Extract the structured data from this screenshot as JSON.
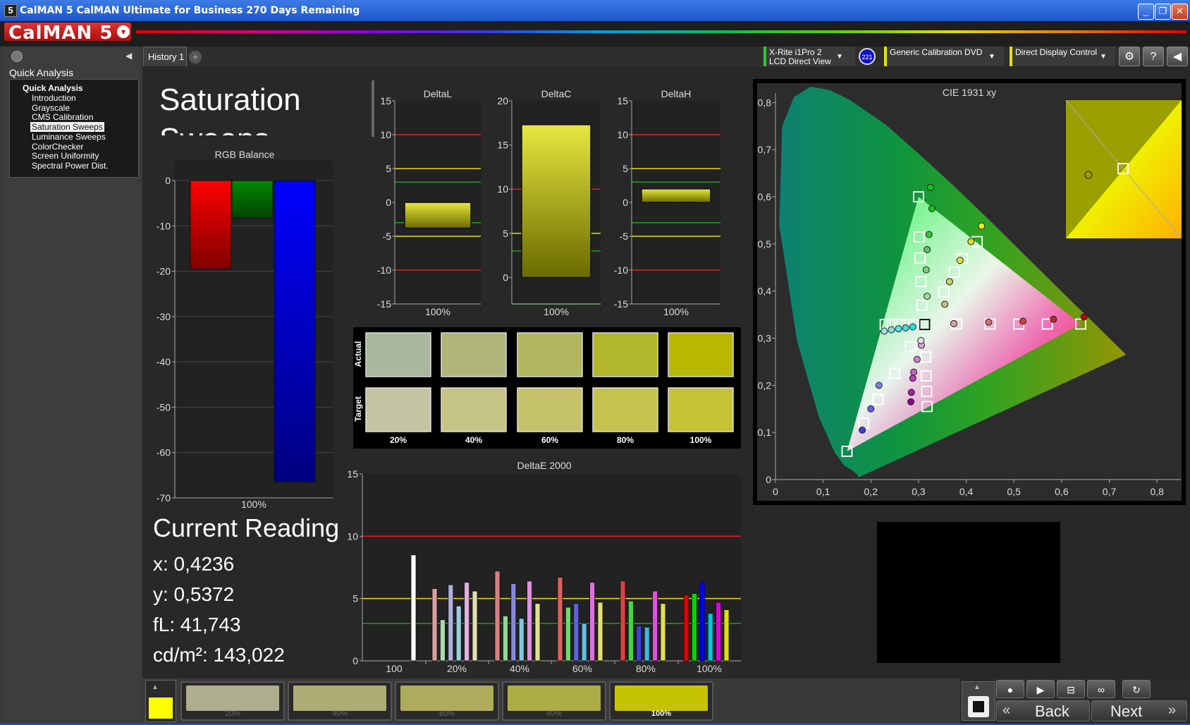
{
  "window": {
    "title": "CalMAN 5 CalMAN Ultimate for Business 270 Days Remaining",
    "icon_label": "5",
    "buttons": {
      "minimize": "_",
      "restore": "❐",
      "close": "✕"
    }
  },
  "logo": {
    "text": "CalMAN 5",
    "menu_glyph": "▾"
  },
  "sidebar": {
    "title": "Quick Analysis",
    "tree_root": "Quick Analysis",
    "items": [
      {
        "label": "Introduction",
        "selected": false
      },
      {
        "label": "Grayscale",
        "selected": false
      },
      {
        "label": "CMS Calibration",
        "selected": false
      },
      {
        "label": "Saturation Sweeps",
        "selected": true
      },
      {
        "label": "Luminance Sweeps",
        "selected": false
      },
      {
        "label": "ColorChecker",
        "selected": false
      },
      {
        "label": "Screen Uniformity",
        "selected": false
      },
      {
        "label": "Spectral Power Dist.",
        "selected": false
      }
    ]
  },
  "tabs": [
    {
      "label": "History 1"
    }
  ],
  "tab_add": "+",
  "devices": {
    "meter": {
      "line1": "X-Rite i1Pro 2",
      "line2": "LCD Direct View",
      "accent": "#2ccc2c"
    },
    "meter_badge": "221",
    "source": {
      "label": "Generic Calibration DVD",
      "accent": "#e8e000"
    },
    "display": {
      "label": "Direct Display Control",
      "accent": "#e8e000"
    }
  },
  "page": {
    "title": "Saturation Sweeps"
  },
  "current_reading": {
    "title": "Current Reading",
    "x": "x: 0,4236",
    "y": "y: 0,5372",
    "fl": "fL: 41,743",
    "cd": "cd/m²: 143,022"
  },
  "chart_data": [
    {
      "id": "rgb-balance",
      "type": "bar",
      "title": "RGB Balance",
      "categories": [
        "100%"
      ],
      "series": [
        {
          "color": "#ff0000",
          "values": [
            -19.5
          ]
        },
        {
          "color": "#008a00",
          "values": [
            -8.3
          ]
        },
        {
          "color": "#0000ff",
          "values": [
            -66.5
          ]
        }
      ],
      "ylim": [
        -70,
        0
      ],
      "yticks": [
        0,
        -10,
        -20,
        -30,
        -40,
        -50,
        -60,
        -70
      ]
    },
    {
      "id": "delta-l",
      "type": "bar",
      "title": "DeltaL",
      "categories": [
        "100%"
      ],
      "values": [
        -3.8
      ],
      "ylim": [
        -15,
        15
      ],
      "yticks": [
        15,
        10,
        5,
        0,
        -5,
        -10,
        -15
      ],
      "ref_lines": [
        {
          "y": 10,
          "color": "#e02020"
        },
        {
          "y": -10,
          "color": "#e02020"
        },
        {
          "y": 5,
          "color": "#e8e000"
        },
        {
          "y": -5,
          "color": "#e8e000"
        },
        {
          "y": 3,
          "color": "#20a020"
        },
        {
          "y": -3,
          "color": "#20a020"
        }
      ]
    },
    {
      "id": "delta-c",
      "type": "bar",
      "title": "DeltaC",
      "categories": [
        "100%"
      ],
      "values": [
        17.3
      ],
      "ylim": [
        -3,
        20
      ],
      "yticks": [
        20,
        15,
        10,
        5,
        0
      ],
      "ref_lines": [
        {
          "y": 10,
          "color": "#e02020"
        },
        {
          "y": 5,
          "color": "#e8e000"
        },
        {
          "y": 3,
          "color": "#20a020"
        },
        {
          "y": -3,
          "color": "#20a020"
        }
      ]
    },
    {
      "id": "delta-h",
      "type": "bar",
      "title": "DeltaH",
      "categories": [
        "100%"
      ],
      "values": [
        2
      ],
      "ylim": [
        -15,
        15
      ],
      "yticks": [
        15,
        10,
        5,
        0,
        -5,
        -10,
        -15
      ],
      "ref_lines": [
        {
          "y": 10,
          "color": "#e02020"
        },
        {
          "y": -10,
          "color": "#e02020"
        },
        {
          "y": 5,
          "color": "#e8e000"
        },
        {
          "y": -5,
          "color": "#e8e000"
        },
        {
          "y": 3,
          "color": "#20a020"
        },
        {
          "y": -3,
          "color": "#20a020"
        }
      ]
    },
    {
      "id": "swatches",
      "type": "table",
      "row_labels": [
        "Actual",
        "Target"
      ],
      "columns": [
        "20%",
        "40%",
        "60%",
        "80%",
        "100%"
      ],
      "actual_colors": [
        "#a9b79c",
        "#b0b478",
        "#b2b65e",
        "#b2b62a",
        "#b8b800"
      ],
      "target_colors": [
        "#c5c4a2",
        "#c6c386",
        "#c6c26c",
        "#c6c24e",
        "#c6c236"
      ]
    },
    {
      "id": "delta-e-2000",
      "type": "bar",
      "title": "DeltaE 2000",
      "categories": [
        "100",
        "20%",
        "40%",
        "60%",
        "80%",
        "100%"
      ],
      "ylim": [
        0,
        15
      ],
      "yticks": [
        15,
        10,
        5,
        0
      ],
      "ref_lines": [
        {
          "y": 10,
          "color": "#e02020"
        },
        {
          "y": 5,
          "color": "#e8e000"
        },
        {
          "y": 3,
          "color": "#20a020"
        }
      ],
      "groups": [
        {
          "category": "100",
          "bars": [
            {
              "color": "#ffffff",
              "value": 8.5
            }
          ]
        },
        {
          "category": "20%",
          "bars": [
            {
              "color": "#d9a0a0",
              "value": 5.8
            },
            {
              "color": "#b0d8b0",
              "value": 3.3
            },
            {
              "color": "#b0b0e0",
              "value": 6.1
            },
            {
              "color": "#a0d0e0",
              "value": 4.4
            },
            {
              "color": "#e0b0e0",
              "value": 6.3
            },
            {
              "color": "#e0e0b0",
              "value": 5.6
            }
          ]
        },
        {
          "category": "40%",
          "bars": [
            {
              "color": "#d98080",
              "value": 7.2
            },
            {
              "color": "#90d890",
              "value": 3.6
            },
            {
              "color": "#8888e0",
              "value": 6.2
            },
            {
              "color": "#80c8e0",
              "value": 3.4
            },
            {
              "color": "#e090e0",
              "value": 6.4
            },
            {
              "color": "#e0e090",
              "value": 4.6
            }
          ]
        },
        {
          "category": "60%",
          "bars": [
            {
              "color": "#e06060",
              "value": 6.7
            },
            {
              "color": "#70d870",
              "value": 4.3
            },
            {
              "color": "#6060e0",
              "value": 4.6
            },
            {
              "color": "#60c0e0",
              "value": 3.0
            },
            {
              "color": "#e070e0",
              "value": 6.3
            },
            {
              "color": "#e0e070",
              "value": 4.7
            }
          ]
        },
        {
          "category": "80%",
          "bars": [
            {
              "color": "#e04040",
              "value": 6.4
            },
            {
              "color": "#40d840",
              "value": 4.8
            },
            {
              "color": "#4040e0",
              "value": 2.8
            },
            {
              "color": "#40b8e0",
              "value": 2.7
            },
            {
              "color": "#e050e0",
              "value": 5.6
            },
            {
              "color": "#e0e050",
              "value": 4.6
            }
          ]
        },
        {
          "category": "100%",
          "bars": [
            {
              "color": "#e00000",
              "value": 5.3
            },
            {
              "color": "#00d800",
              "value": 5.4
            },
            {
              "color": "#0000ff",
              "value": 6.3
            },
            {
              "color": "#00c8e0",
              "value": 3.8
            },
            {
              "color": "#e000e0",
              "value": 4.7
            },
            {
              "color": "#e0e000",
              "value": 4.1
            }
          ]
        }
      ]
    },
    {
      "id": "cie-1931",
      "type": "scatter",
      "title": "CIE 1931 xy",
      "xlim": [
        0,
        0.85
      ],
      "ylim": [
        0,
        0.85
      ],
      "xticks": [
        "0",
        "0,1",
        "0,2",
        "0,3",
        "0,4",
        "0,5",
        "0,6",
        "0,7",
        "0,8"
      ],
      "yticks": [
        "0",
        "0,1",
        "0,2",
        "0,3",
        "0,4",
        "0,5",
        "0,6",
        "0,7",
        "0,8"
      ],
      "gamut": [
        [
          0.64,
          0.33
        ],
        [
          0.3,
          0.6
        ],
        [
          0.15,
          0.06
        ]
      ],
      "white": [
        0.3127,
        0.329
      ],
      "targets": [
        [
          0.3127,
          0.329
        ],
        [
          0.38,
          0.33
        ],
        [
          0.45,
          0.33
        ],
        [
          0.51,
          0.33
        ],
        [
          0.57,
          0.33
        ],
        [
          0.64,
          0.33
        ],
        [
          0.307,
          0.37
        ],
        [
          0.305,
          0.42
        ],
        [
          0.303,
          0.47
        ],
        [
          0.301,
          0.515
        ],
        [
          0.3,
          0.6
        ],
        [
          0.353,
          0.398
        ],
        [
          0.375,
          0.44
        ],
        [
          0.392,
          0.469
        ],
        [
          0.423,
          0.505
        ],
        [
          0.283,
          0.282
        ],
        [
          0.25,
          0.225
        ],
        [
          0.215,
          0.17
        ],
        [
          0.185,
          0.12
        ],
        [
          0.15,
          0.06
        ],
        [
          0.23,
          0.329
        ],
        [
          0.245,
          0.329
        ],
        [
          0.26,
          0.329
        ],
        [
          0.275,
          0.329
        ],
        [
          0.29,
          0.329
        ],
        [
          0.315,
          0.26
        ],
        [
          0.316,
          0.22
        ],
        [
          0.317,
          0.187
        ],
        [
          0.318,
          0.155
        ]
      ],
      "measured": [
        [
          0.374,
          0.331
        ],
        [
          0.447,
          0.334
        ],
        [
          0.519,
          0.336
        ],
        [
          0.583,
          0.34
        ],
        [
          0.647,
          0.345
        ],
        [
          0.318,
          0.389
        ],
        [
          0.316,
          0.445
        ],
        [
          0.318,
          0.488
        ],
        [
          0.322,
          0.52
        ],
        [
          0.325,
          0.62
        ],
        [
          0.328,
          0.575
        ],
        [
          0.355,
          0.372
        ],
        [
          0.365,
          0.42
        ],
        [
          0.387,
          0.465
        ],
        [
          0.41,
          0.505
        ],
        [
          0.432,
          0.538
        ],
        [
          0.306,
          0.285
        ],
        [
          0.297,
          0.255
        ],
        [
          0.29,
          0.228
        ],
        [
          0.288,
          0.215
        ],
        [
          0.285,
          0.185
        ],
        [
          0.284,
          0.165
        ],
        [
          0.305,
          0.295
        ],
        [
          0.217,
          0.2
        ],
        [
          0.2,
          0.15
        ],
        [
          0.182,
          0.105
        ],
        [
          0.228,
          0.315
        ],
        [
          0.243,
          0.318
        ],
        [
          0.258,
          0.32
        ],
        [
          0.273,
          0.322
        ],
        [
          0.288,
          0.324
        ]
      ],
      "measured_colors": [
        "#e0a0a0",
        "#d87070",
        "#d04040",
        "#c82020",
        "#c80000",
        "#a0e0a0",
        "#80d080",
        "#60c060",
        "#40c040",
        "#20c020",
        "#20c020",
        "#c0c080",
        "#d0d060",
        "#e0e040",
        "#e0e020",
        "#f0f000",
        "#e0a0e0",
        "#d080d0",
        "#c060c0",
        "#b040b0",
        "#a020a0",
        "#900090",
        "#e0e0e0",
        "#8080e0",
        "#6060e0",
        "#4040e0",
        "#a0e0e0",
        "#80e0e0",
        "#60e0e0",
        "#40e0e0",
        "#20e0e0"
      ],
      "inset": {
        "measured": [
          0.4236,
          0.5372
        ],
        "target": [
          0.423,
          0.505
        ]
      }
    }
  ],
  "patches": [
    {
      "label": "20%",
      "color": "#c6c4a0",
      "active": false
    },
    {
      "label": "40%",
      "color": "#c6c482",
      "active": false
    },
    {
      "label": "60%",
      "color": "#c6c266",
      "active": false
    },
    {
      "label": "80%",
      "color": "#c6c44a",
      "active": false
    },
    {
      "label": "100%",
      "color": "#c6c400",
      "active": true
    }
  ],
  "current_patch_color": "#ffff00",
  "controls": {
    "back": "Back",
    "next": "Next",
    "back_glyph": "«",
    "next_glyph": "»"
  }
}
